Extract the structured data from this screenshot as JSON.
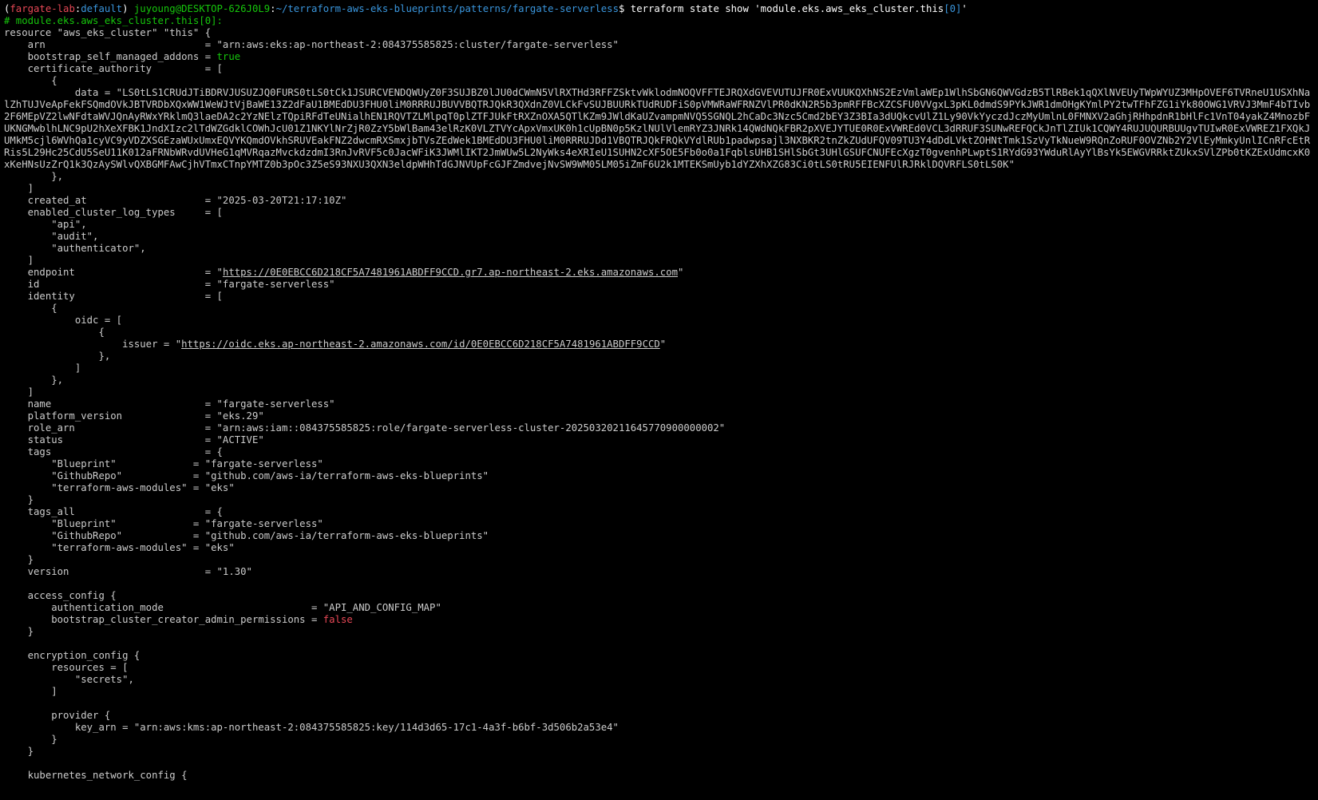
{
  "prompt": {
    "open_paren": "(",
    "lab": "fargate-lab",
    "colon1": ":",
    "profile": "default",
    "close_paren": ") ",
    "userhost": "juyoung@DESKTOP-626J0L9",
    "colon2": ":",
    "path": "~/terraform-aws-eks-blueprints/patterns/fargate-serverless",
    "dollar": "$ ",
    "command": "terraform state show 'module.eks.aws_eks_cluster.this",
    "command_index": "[0]",
    "command_end": "'"
  },
  "colors": {
    "background": "#000000",
    "text": "#cccccc",
    "red": "#e74856",
    "green": "#16c60c",
    "blue": "#4aa0ff",
    "cyan": "#3a96dd"
  },
  "lines": [
    [
      {
        "t": "# module.eks.aws_eks_cluster.this[0]:",
        "c": "c-green"
      }
    ],
    [
      {
        "t": "resource \"aws_eks_cluster\" \"this\" {"
      }
    ],
    [
      {
        "t": "    arn                           = \"arn:aws:eks:ap-northeast-2:084375585825:cluster/fargate-serverless\""
      }
    ],
    [
      {
        "t": "    bootstrap_self_managed_addons = "
      },
      {
        "t": "true",
        "c": "c-green"
      }
    ],
    [
      {
        "t": "    certificate_authority         = ["
      }
    ],
    [
      {
        "t": "        {"
      }
    ],
    [
      {
        "t": "            data = \"LS0tLS1CRUdJTiBDRVJUSUZJQ0FURS0tLS0tCk1JSURCVENDQWUyZ0F3SUJBZ0lJU0dCWmN5VlRXTHd3RFFZSktvWklodmNOQVFFTEJRQXdGVEVUTUJFR0ExVUUKQXhNS2EzVmlaWEp1WlhSbGN6QWVGdzB5TlRBek1qQXlNVEUyTWpWYUZ3MHpOVEF6TVRneU1USXhNalZhTUJVeApFekFSQmdOVkJBTVRDbXQxWW1WeWJtVjBaWE13Z2dFaU1BMEdDU3FHU0liM0RRRUJBUVVBQTRJQkR3QXdnZ0VLCkFvSUJBUURkTUdRUDFiS0pVMWRaWFRNZVlPR0dKN2R5b3pmRFFBcXZCSFU0VVgxL3pKL0dmdS9PYkJWR1dmOHgKYmlPY2twTFhFZG1iYk80OWG1VRVJ3MmF4bTIvb2F6MEpVZ2lwNFdtaWVJQnAyRWxYRklmQ3laeDA2c2YzNElzTQpiRFdTeUNialhEN1RQVTZLMlpqT0plZTFJUkFtRXZnOXA5QTlKZm9JWldKaUZvampmNVQ5SGNQL2hCaDc3Nzc5Cmd2bEY3Z3BIa3dUQkcvUlZ1Ly90VkYyczdJczMyUmlnL0FMNXV2aGhjRHhpdnR1bHlFc1VnT04yakZ4MnozbFUKNGMwblhLNC9pU2hXeXFBK1JndXIzc2lTdWZGdklCOWhJcU01Z1NKYlNrZjR0ZzY5bWlBam43elRzK0VLZTVYcApxVmxUK0h1cUpBN0p5KzlNUlVlemRYZ3JNRk14QWdNQkFBR2pXVEJYTUE0R0ExVWREd0VCL3dRRUF3SUNwREFQCkJnTlZIUk1CQWY4RUJUQURBUUgvTUIwR0ExVWREZ1FXQkJUMkM5cjl6WVhQa1cyVC9yVDZXSGEzaWUxUmxEQVYKQmdOVkhSRUVEakFNZ2dwcmRXSmxjbTVsZEdWek1BMEdDU3FHU0liM0RRRUJDd1VBQTRJQkFRQkVYdlRUb1padwpsajl3NXBKR2tnZkZUdUFQV09TU3Y4dDdLVktZOHNtTmk1SzVyTkNueW9RQnZoRUF0OVZNb2Y2VlEyMmkyUnlICnRFcEtRRis5L29Hc25CdU5SeU11K012aFRNbWRvdUVHeG1qMVRqazMvckdzdmI3RnJvRVF5c0JacWFiK3JWMlIKT2JmWUw5L2NyWks4eXRIeU1SUHN2cXF5OE5Fb0o0a1FqblsUHB1SHlSbGt3UHlGSUFCNUFEcXgzT0gvenhPLwptS1RYdG93YWduRlAyYlBsYk5EWGVRRktZUkxSVlZPb0tKZExUdmcxK0xKeHNsUzZrQ1k3QzAySWlvQXBGMFAwCjhVTmxCTnpYMTZ0b3pOc3Z5eS93NXU3QXN3eldpWHhTdGJNVUpFcGJFZmdvejNvSW9WM05LM05iZmF6U2k1MTEKSmUyb1dYZXhXZG83Ci0tLS0tRU5EIENFUlRJRklDQVRFLS0tLS0K\"",
        "wrap": true
      }
    ],
    [
      {
        "t": "        },"
      }
    ],
    [
      {
        "t": "    ]"
      }
    ],
    [
      {
        "t": "    created_at                    = \"2025-03-20T21:17:10Z\""
      }
    ],
    [
      {
        "t": "    enabled_cluster_log_types     = ["
      }
    ],
    [
      {
        "t": "        \"api\","
      }
    ],
    [
      {
        "t": "        \"audit\","
      }
    ],
    [
      {
        "t": "        \"authenticator\","
      }
    ],
    [
      {
        "t": "    ]"
      }
    ],
    [
      {
        "t": "    endpoint                      = \""
      },
      {
        "t": "https://0E0EBCC6D218CF5A7481961ABDFF9CCD.gr7.ap-northeast-2.eks.amazonaws.com",
        "c": "link"
      },
      {
        "t": "\""
      }
    ],
    [
      {
        "t": "    id                            = \"fargate-serverless\""
      }
    ],
    [
      {
        "t": "    identity                      = ["
      }
    ],
    [
      {
        "t": "        {"
      }
    ],
    [
      {
        "t": "            oidc = ["
      }
    ],
    [
      {
        "t": "                {"
      }
    ],
    [
      {
        "t": "                    issuer = \""
      },
      {
        "t": "https://oidc.eks.ap-northeast-2.amazonaws.com/id/0E0EBCC6D218CF5A7481961ABDFF9CCD",
        "c": "link"
      },
      {
        "t": "\""
      }
    ],
    [
      {
        "t": "                },"
      }
    ],
    [
      {
        "t": "            ]"
      }
    ],
    [
      {
        "t": "        },"
      }
    ],
    [
      {
        "t": "    ]"
      }
    ],
    [
      {
        "t": "    name                          = \"fargate-serverless\""
      }
    ],
    [
      {
        "t": "    platform_version              = \"eks.29\""
      }
    ],
    [
      {
        "t": "    role_arn                      = \"arn:aws:iam::084375585825:role/fargate-serverless-cluster-20250320211645770900000002\""
      }
    ],
    [
      {
        "t": "    status                        = \"ACTIVE\""
      }
    ],
    [
      {
        "t": "    tags                          = {"
      }
    ],
    [
      {
        "t": "        \"Blueprint\"             = \"fargate-serverless\""
      }
    ],
    [
      {
        "t": "        \"GithubRepo\"            = \"github.com/aws-ia/terraform-aws-eks-blueprints\""
      }
    ],
    [
      {
        "t": "        \"terraform-aws-modules\" = \"eks\""
      }
    ],
    [
      {
        "t": "    }"
      }
    ],
    [
      {
        "t": "    tags_all                      = {"
      }
    ],
    [
      {
        "t": "        \"Blueprint\"             = \"fargate-serverless\""
      }
    ],
    [
      {
        "t": "        \"GithubRepo\"            = \"github.com/aws-ia/terraform-aws-eks-blueprints\""
      }
    ],
    [
      {
        "t": "        \"terraform-aws-modules\" = \"eks\""
      }
    ],
    [
      {
        "t": "    }"
      }
    ],
    [
      {
        "t": "    version                       = \"1.30\""
      }
    ],
    [
      {
        "t": ""
      }
    ],
    [
      {
        "t": "    access_config {"
      }
    ],
    [
      {
        "t": "        authentication_mode                         = \"API_AND_CONFIG_MAP\""
      }
    ],
    [
      {
        "t": "        bootstrap_cluster_creator_admin_permissions = "
      },
      {
        "t": "false",
        "c": "c-red"
      }
    ],
    [
      {
        "t": "    }"
      }
    ],
    [
      {
        "t": ""
      }
    ],
    [
      {
        "t": "    encryption_config {"
      }
    ],
    [
      {
        "t": "        resources = ["
      }
    ],
    [
      {
        "t": "            \"secrets\","
      }
    ],
    [
      {
        "t": "        ]"
      }
    ],
    [
      {
        "t": ""
      }
    ],
    [
      {
        "t": "        provider {"
      }
    ],
    [
      {
        "t": "            key_arn = \"arn:aws:kms:ap-northeast-2:084375585825:key/114d3d65-17c1-4a3f-b6bf-3d506b2a53e4\""
      }
    ],
    [
      {
        "t": "        }"
      }
    ],
    [
      {
        "t": "    }"
      }
    ],
    [
      {
        "t": ""
      }
    ],
    [
      {
        "t": "    kubernetes_network_config {"
      }
    ]
  ]
}
